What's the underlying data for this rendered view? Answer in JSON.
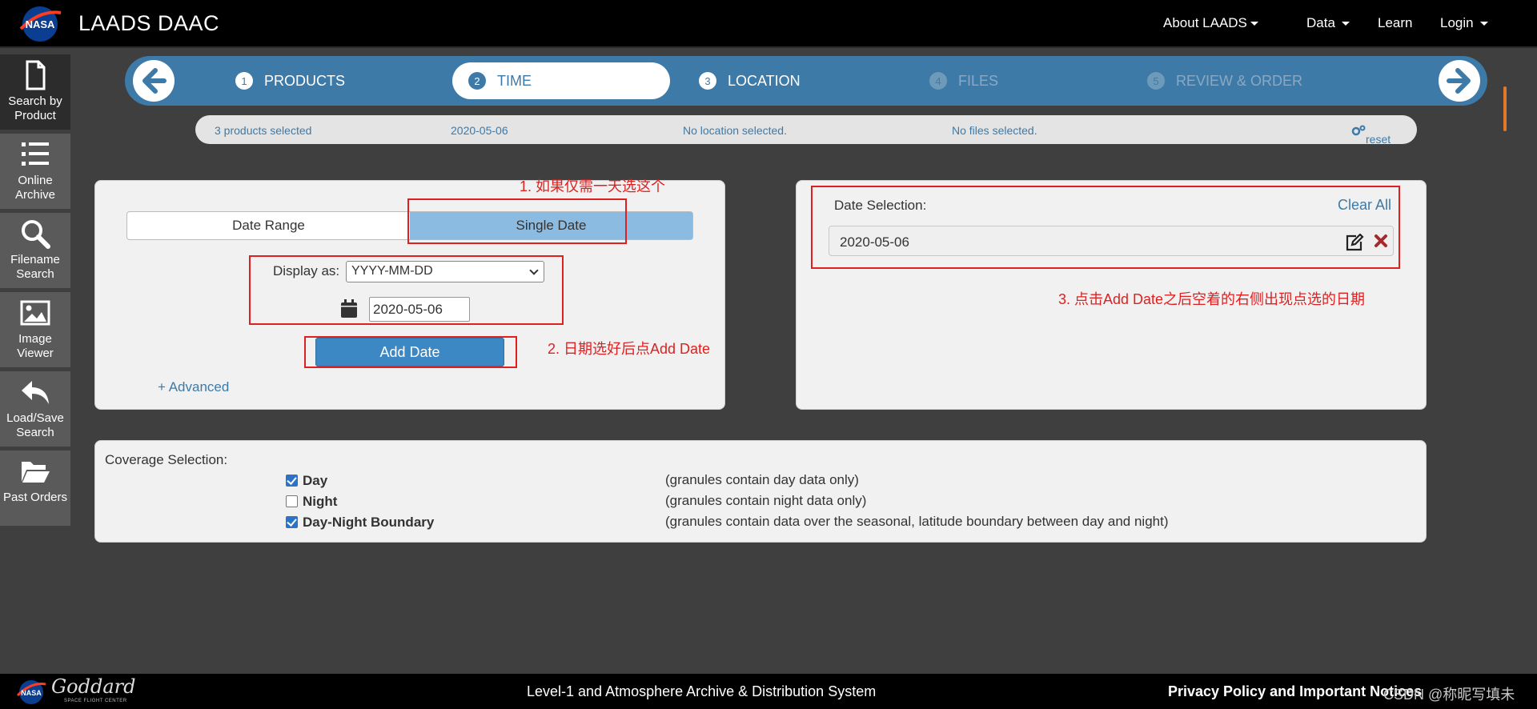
{
  "header": {
    "brand": "LAADS DAAC",
    "logo_text": "NASA",
    "nav": [
      {
        "label": "About LAADS",
        "has_caret": true
      },
      {
        "label": "Data",
        "has_caret": true
      },
      {
        "label": "Learn",
        "has_caret": false
      },
      {
        "label": "Login",
        "has_caret": true
      }
    ]
  },
  "sidebar": {
    "items": [
      {
        "label": "Search by Product",
        "icon": "document-icon",
        "active": true
      },
      {
        "label": "Online Archive",
        "icon": "list-icon",
        "active": false
      },
      {
        "label": "Filename Search",
        "icon": "search-icon",
        "active": false
      },
      {
        "label": "Image Viewer",
        "icon": "image-icon",
        "active": false
      },
      {
        "label": "Load/Save Search",
        "icon": "reply-icon",
        "active": false
      },
      {
        "label": "Past Orders",
        "icon": "folder-open-icon",
        "active": false
      }
    ]
  },
  "wizard": {
    "steps": [
      {
        "num": "1",
        "label": "PRODUCTS",
        "state": "done"
      },
      {
        "num": "2",
        "label": "TIME",
        "state": "active"
      },
      {
        "num": "3",
        "label": "LOCATION",
        "state": "done"
      },
      {
        "num": "4",
        "label": "FILES",
        "state": "disabled"
      },
      {
        "num": "5",
        "label": "REVIEW & ORDER",
        "state": "disabled"
      }
    ]
  },
  "summary": {
    "products": "3 products selected",
    "date": "2020-05-06",
    "location": "No location selected.",
    "files": "No files selected.",
    "reset": "reset"
  },
  "time_panel": {
    "tab_range": "Date Range",
    "tab_single": "Single Date",
    "display_as_label": "Display as:",
    "display_format": "YYYY-MM-DD",
    "date_value": "2020-05-06",
    "add_button": "Add Date",
    "advanced_link": "+ Advanced"
  },
  "selection_panel": {
    "title": "Date Selection:",
    "clear_all": "Clear All",
    "dates": [
      "2020-05-06"
    ]
  },
  "coverage": {
    "title": "Coverage Selection:",
    "options": [
      {
        "name": "Day",
        "checked": true,
        "desc": "(granules contain day data only)"
      },
      {
        "name": "Night",
        "checked": false,
        "desc": "(granules contain night data only)"
      },
      {
        "name": "Day-Night Boundary",
        "checked": true,
        "desc": "(granules contain data over the seasonal, latitude boundary between day and night)"
      }
    ]
  },
  "annotations": {
    "note1": "1. 如果仅需一天选这个",
    "note2": "2. 日期选好后点Add Date",
    "note3": "3. 点击Add Date之后空着的右侧出现点选的日期"
  },
  "footer": {
    "goddard": "Goddard",
    "goddard_sub": "SPACE FLIGHT CENTER",
    "center_text": "Level-1 and Atmosphere Archive & Distribution System",
    "right_text": "Privacy Policy and Important Notices",
    "watermark": "CSDN @称昵写填未"
  },
  "colors": {
    "accent": "#3d7aa8",
    "annotation": "#e02020",
    "checkbox": "#2a73c8"
  }
}
